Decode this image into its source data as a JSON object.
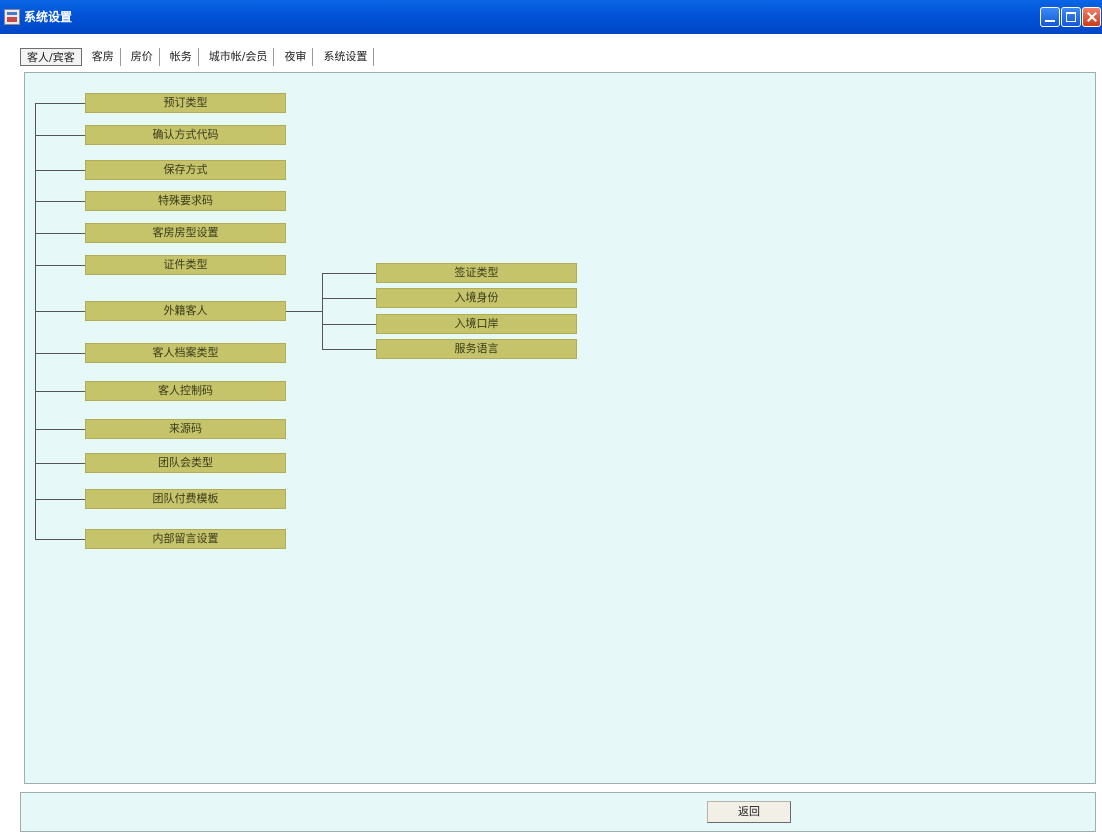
{
  "window": {
    "title": "系统设置",
    "buttons": {
      "minimize_icon": "minimize-icon",
      "maximize_icon": "maximize-icon",
      "close_icon": "close-icon"
    }
  },
  "tabs": [
    {
      "label": "客人/宾客",
      "active": true
    },
    {
      "label": "客房"
    },
    {
      "label": "房价"
    },
    {
      "label": "帐务"
    },
    {
      "label": "城市帐/会员"
    },
    {
      "label": "夜审"
    },
    {
      "label": "系统设置"
    }
  ],
  "tree": {
    "items": [
      {
        "label": "预订类型"
      },
      {
        "label": "确认方式代码"
      },
      {
        "label": "保存方式"
      },
      {
        "label": "特殊要求码"
      },
      {
        "label": "客房房型设置"
      },
      {
        "label": "证件类型"
      },
      {
        "label": "外籍客人",
        "children": [
          {
            "label": "签证类型"
          },
          {
            "label": "入境身份"
          },
          {
            "label": "入境口岸"
          },
          {
            "label": "服务语言"
          }
        ]
      },
      {
        "label": "客人档案类型"
      },
      {
        "label": "客人控制码"
      },
      {
        "label": "来源码"
      },
      {
        "label": "团队会类型"
      },
      {
        "label": "团队付费模板"
      },
      {
        "label": "内部留言设置"
      }
    ]
  },
  "footer": {
    "back_label": "返回"
  },
  "colors": {
    "node_fill": "#c6c46b",
    "panel_bg": "#e6f8f8",
    "titlebar": "#0254d8"
  }
}
